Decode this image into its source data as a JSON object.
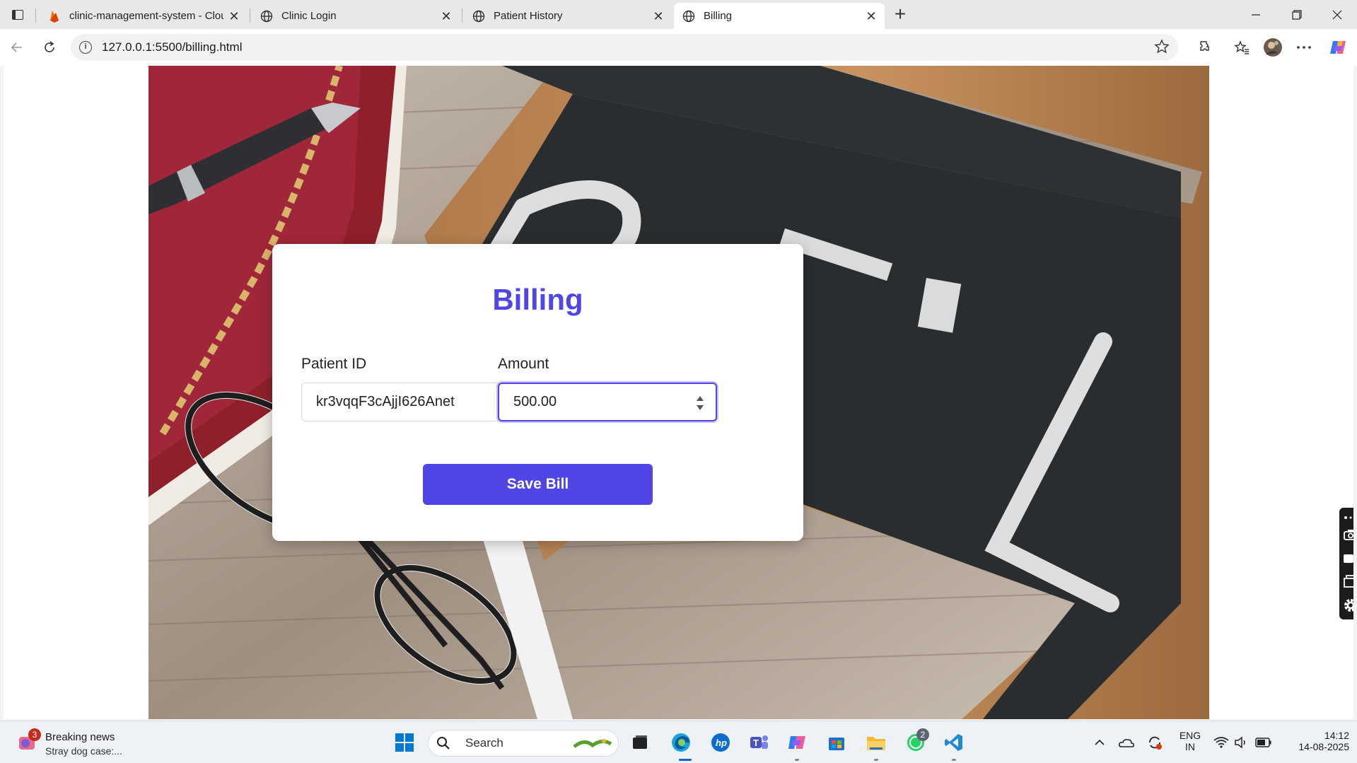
{
  "browser": {
    "tabs": [
      {
        "title": "clinic-management-system - Clou",
        "icon": "firebase-icon",
        "active": false
      },
      {
        "title": "Clinic Login",
        "icon": "globe-icon",
        "active": false
      },
      {
        "title": "Patient History",
        "icon": "globe-icon",
        "active": false
      },
      {
        "title": "Billing",
        "icon": "globe-icon",
        "active": true
      }
    ],
    "url": "127.0.0.1:5500/billing.html"
  },
  "page": {
    "background_image": "chalkboard-bill-photo",
    "form": {
      "title": "Billing",
      "patient_id_label": "Patient ID",
      "patient_id_value": "kr3vqqF3cAjjI626Anet",
      "amount_label": "Amount",
      "amount_value": "500.00",
      "submit_label": "Save Bill"
    },
    "colors": {
      "accent": "#4f46e5"
    }
  },
  "taskbar": {
    "news": {
      "badge": "3",
      "title": "Breaking news",
      "subtitle": "Stray dog case:..."
    },
    "search_placeholder": "Search",
    "whatsapp_badge": "2",
    "tray": {
      "lang_top": "ENG",
      "lang_bottom": "IN",
      "time": "14:12",
      "date": "14-08-2025"
    }
  }
}
